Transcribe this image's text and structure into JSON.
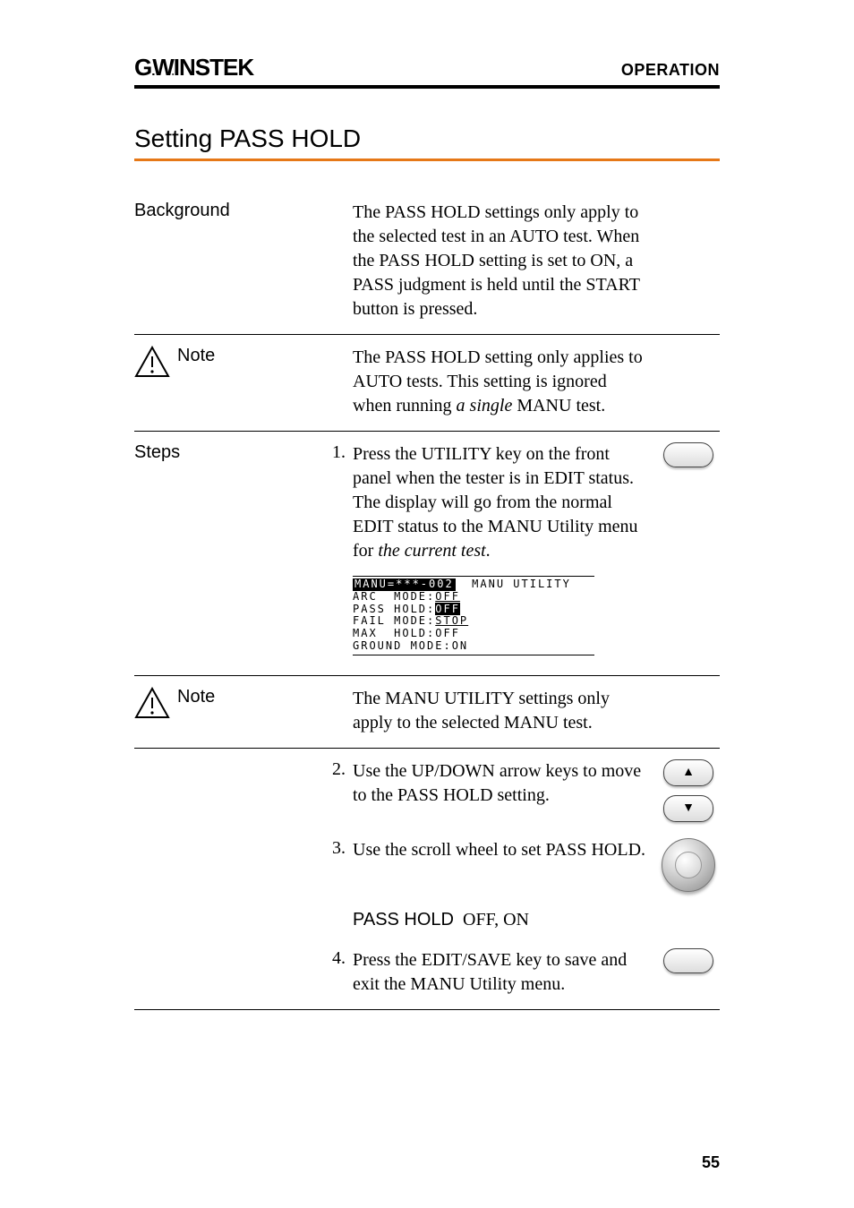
{
  "header": {
    "brand_prefix": "G",
    "brand_u": "W",
    "brand_rest": "INSTEK",
    "operation": "OPERATION"
  },
  "section_title": "Setting PASS HOLD",
  "rows": {
    "background_label": "Background",
    "background_text": "The PASS HOLD settings only apply to the selected test in an AUTO test. When the PASS HOLD setting is set to ON, a PASS judgment is held until the START button is pressed.",
    "note1_label": "Note",
    "note1_text_a": "The PASS HOLD setting only applies to AUTO tests. This setting is ignored when running ",
    "note1_text_b": "a single",
    "note1_text_c": " MANU test.",
    "steps_label": "Steps",
    "step1_num": "1.",
    "step1_text_a": "Press the UTILITY key on the front panel when the tester is in EDIT status. The display will go from the normal EDIT status to the MANU Utility menu for ",
    "step1_text_b": "the current test",
    "step1_text_c": ".",
    "note2_label": "Note",
    "note2_text": "The MANU UTILITY settings only apply to the selected MANU test.",
    "step2_num": "2.",
    "step2_text": "Use the UP/DOWN arrow keys to move to the PASS HOLD setting.",
    "step3_num": "3.",
    "step3_text": "Use the scroll wheel to set PASS HOLD.",
    "passhold_label": "PASS HOLD",
    "passhold_values": "OFF, ON",
    "step4_num": "4.",
    "step4_text": "Press the EDIT/SAVE key to save and exit the MANU Utility menu."
  },
  "screen": {
    "line1_a": "MANU=***-002",
    "line1_b": "  MANU UTILITY",
    "line2": "ARC  MODE:",
    "line2_val": "OFF",
    "line3": "PASS HOLD:",
    "line3_val": "OFF",
    "line4": "FAIL MODE:",
    "line4_val": "STOP",
    "line5": "MAX  HOLD:OFF",
    "line6": "GROUND MODE:ON"
  },
  "page_number": "55"
}
